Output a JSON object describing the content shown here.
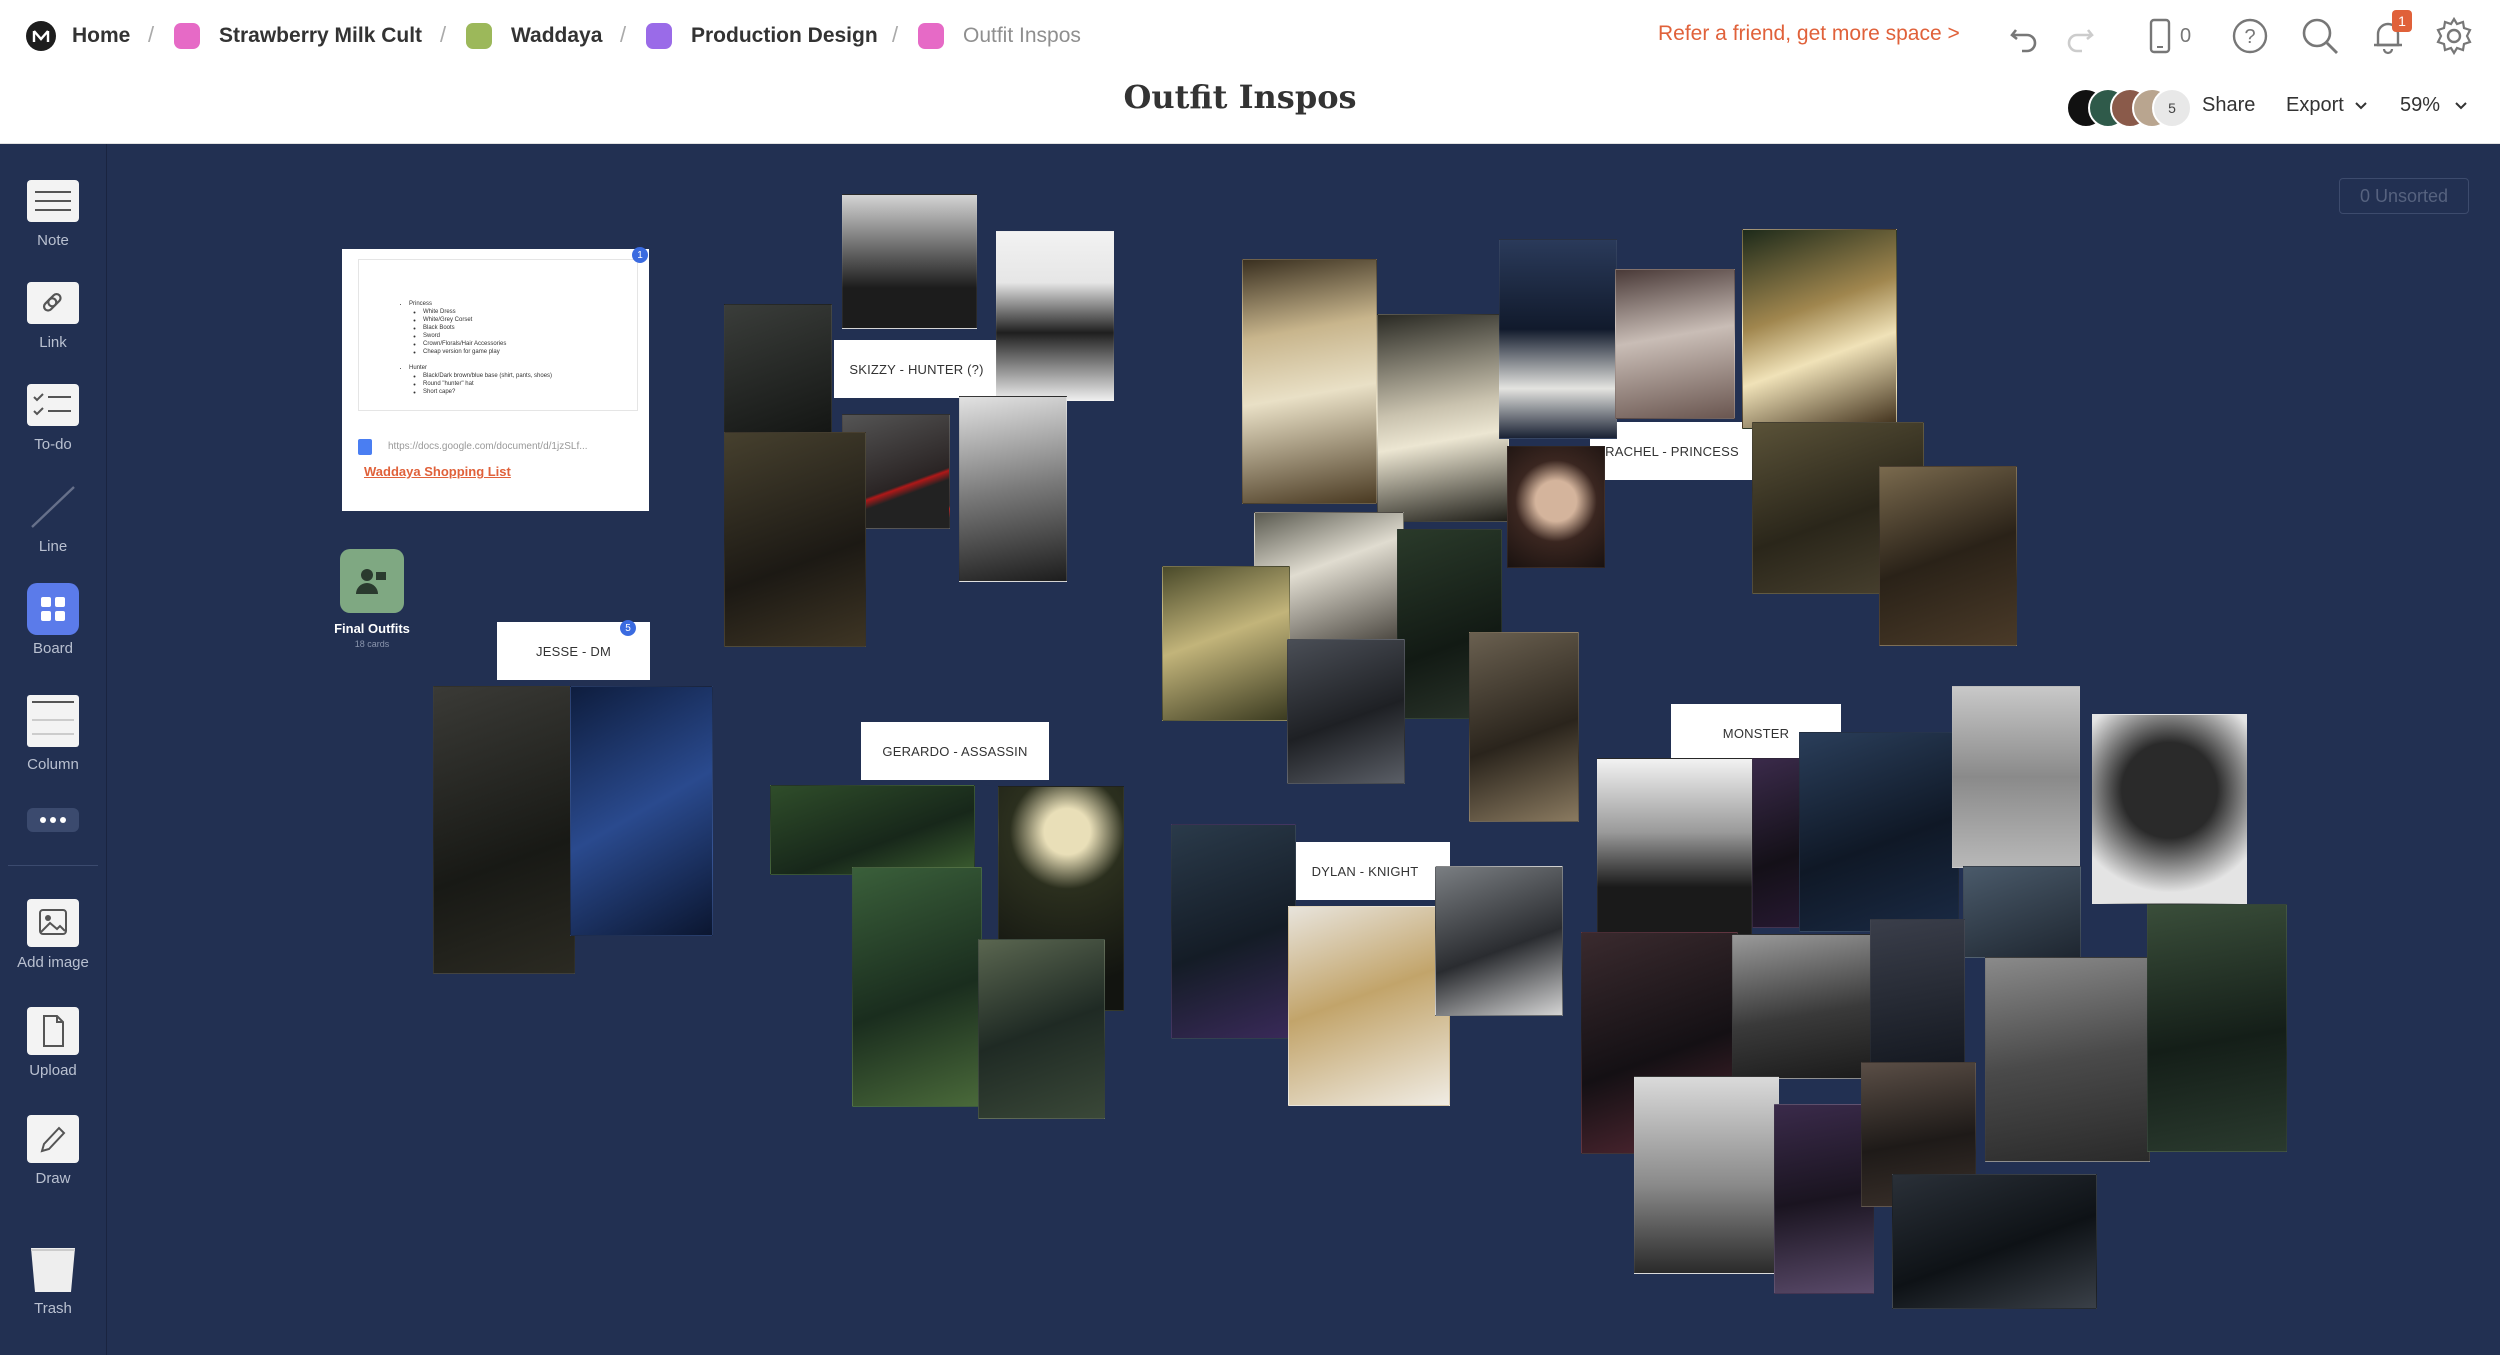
{
  "breadcrumbs": [
    {
      "label": "Home",
      "color": ""
    },
    {
      "label": "Strawberry Milk Cult",
      "color": "#e66ac6"
    },
    {
      "label": "Waddaya",
      "color": "#9cb85a"
    },
    {
      "label": "Production Design",
      "color": "#9a6be8"
    },
    {
      "label": "Outfit Inspos",
      "color": "#e66ac6"
    }
  ],
  "topbar": {
    "refer": "Refer a friend, get more space >",
    "device_count": "0",
    "notif_count": "1",
    "title": "Outfit Inspos",
    "collab_count": "5",
    "share": "Share",
    "export": "Export",
    "zoom": "59%"
  },
  "sidebar": {
    "items": [
      "Note",
      "Link",
      "To-do",
      "Line",
      "Board",
      "Column",
      "Add image",
      "Upload",
      "Draw",
      "Trash"
    ]
  },
  "canvas": {
    "unsorted": "0 Unsorted",
    "doc_card": {
      "bullets": [
        "Princess",
        "White Dress",
        "White/Grey Corset",
        "Black Boots",
        "Sword",
        "Crown/Florals/Hair Accessories",
        "Cheap version for game play",
        "Hunter",
        "Black/Dark brown/blue base (shirt, pants, shoes)",
        "Round \"hunter\" hat",
        "Short cape?"
      ],
      "url": "https://docs.google.com/document/d/1jzSLf...",
      "link": "Waddaya Shopping List",
      "badge": "1"
    },
    "board": {
      "title": "Final Outfits",
      "sub": "18 cards"
    },
    "labels": {
      "jesse": "JESSE - DM",
      "skizzy": "SKIZZY - HUNTER (?)",
      "gerardo": "GERARDO - ASSASSIN",
      "rachel": "RACHEL - PRINCESS",
      "dylan": "DYLAN - KNIGHT",
      "monster": "MONSTER",
      "jesse_badge": "5"
    }
  }
}
